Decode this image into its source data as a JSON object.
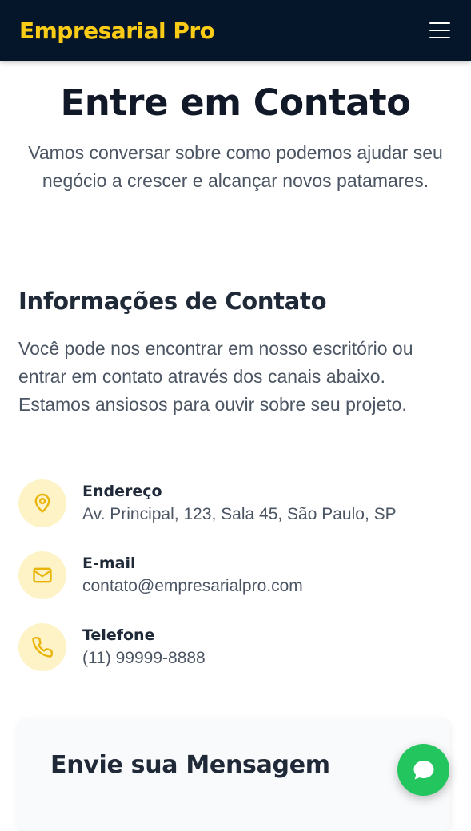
{
  "header": {
    "brand": "Empresarial Pro",
    "menu_icon": "hamburger-menu-icon"
  },
  "hero": {
    "title": "Entre em Contato",
    "subtitle": "Vamos conversar sobre como podemos ajudar seu negócio a crescer e alcançar novos patamares."
  },
  "info": {
    "title": "Informações de Contato",
    "text": "Você pode nos encontrar em nosso escritório ou entrar em contato através dos canais abaixo. Estamos ansiosos para ouvir sobre seu projeto.",
    "items": [
      {
        "icon": "map-pin-icon",
        "label": "Endereço",
        "value": "Av. Principal, 123, Sala 45, São Paulo, SP"
      },
      {
        "icon": "mail-icon",
        "label": "E-mail",
        "value": "contato@empresarialpro.com"
      },
      {
        "icon": "phone-icon",
        "label": "Telefone",
        "value": "(11) 99999-8888"
      }
    ]
  },
  "form": {
    "title": "Envie sua Mensagem"
  },
  "chat": {
    "icon": "chat-bubble-icon"
  },
  "colors": {
    "navbar_bg": "#06162a",
    "brand": "#facc15",
    "icon_circle_bg": "#fef3c7",
    "icon_stroke": "#eab308",
    "chat_button": "#22c55e"
  }
}
